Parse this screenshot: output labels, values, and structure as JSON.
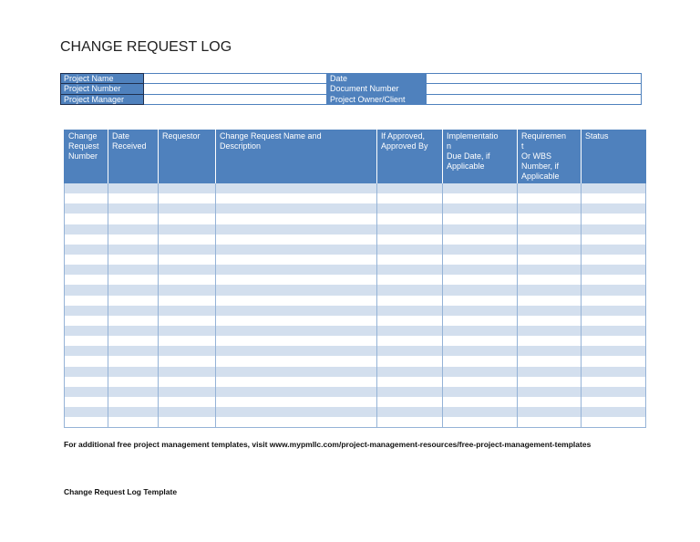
{
  "title": "CHANGE REQUEST LOG",
  "info": {
    "project_name": "Project Name",
    "date": "Date",
    "project_number": "Project Number",
    "document_number": "Document Number",
    "project_manager": "Project Manager",
    "project_owner": "Project Owner/Client"
  },
  "log": {
    "headers": [
      "Change\nRequest\nNumber",
      "Date\nReceived",
      "Requestor",
      "Change Request Name and\nDescription",
      "If Approved,\nApproved By",
      "Implementatio\nn\nDue Date, if\nApplicable",
      "Requiremen\nt\nOr WBS\nNumber, if\nApplicable",
      "Status"
    ],
    "row_count": 24
  },
  "footer": "For additional free project management templates, visit www.mypmllc.com/project-management-resources/free-project-management-templates",
  "footer2": "Change Request Log Template"
}
